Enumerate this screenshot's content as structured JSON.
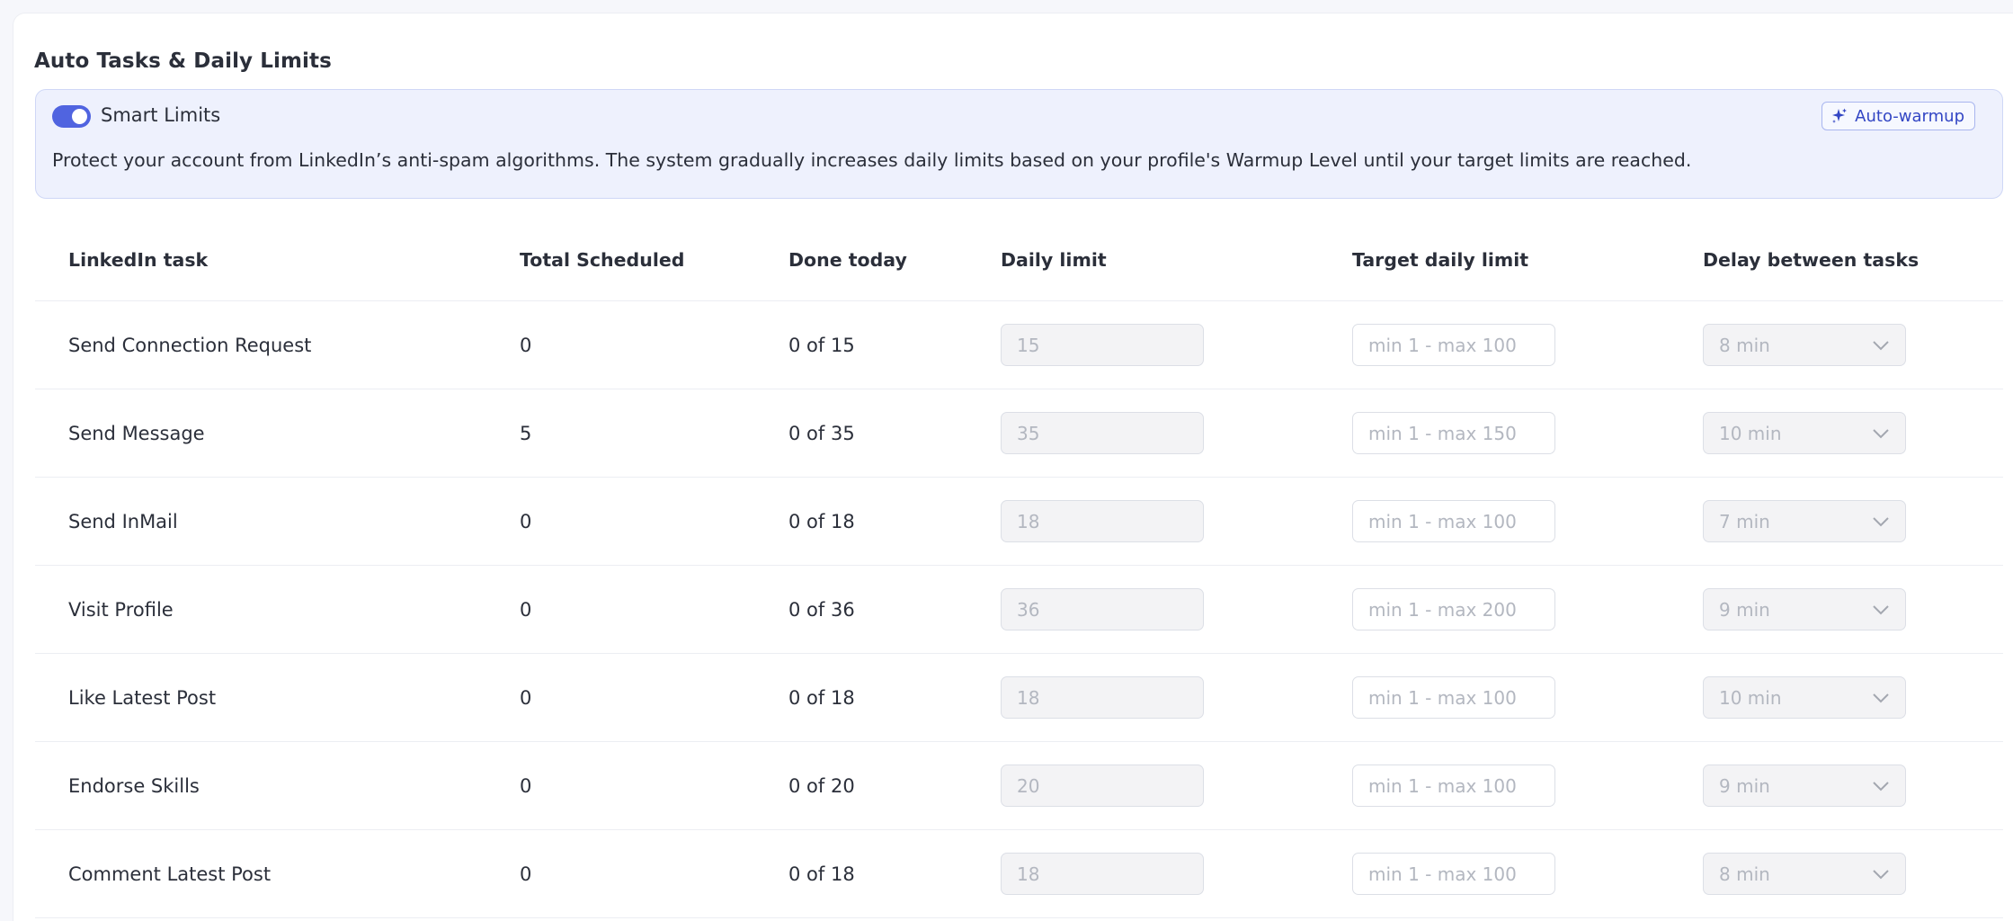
{
  "card": {
    "title": "Auto Tasks & Daily Limits"
  },
  "smart_limits": {
    "enabled": true,
    "label": "Smart Limits",
    "auto_warmup_label": "Auto-warmup",
    "description": "Protect your account from LinkedIn’s anti-spam algorithms. The system gradually increases daily limits based on your profile's Warmup Level until your target limits are reached.",
    "accent_color": "#5064e0"
  },
  "table": {
    "headers": [
      "LinkedIn task",
      "Total Scheduled",
      "Done today",
      "Daily limit",
      "Target daily limit",
      "Delay between tasks"
    ],
    "rows": [
      {
        "task": "Send Connection Request",
        "total": "0",
        "done": "0 of 15",
        "daily_limit": "15",
        "target_placeholder": "min 1 - max 100",
        "delay": "8 min"
      },
      {
        "task": "Send Message",
        "total": "5",
        "done": "0 of 35",
        "daily_limit": "35",
        "target_placeholder": "min 1 - max 150",
        "delay": "10 min"
      },
      {
        "task": "Send InMail",
        "total": "0",
        "done": "0 of 18",
        "daily_limit": "18",
        "target_placeholder": "min 1 - max 100",
        "delay": "7 min"
      },
      {
        "task": "Visit Profile",
        "total": "0",
        "done": "0 of 36",
        "daily_limit": "36",
        "target_placeholder": "min 1 - max 200",
        "delay": "9 min"
      },
      {
        "task": "Like Latest Post",
        "total": "0",
        "done": "0 of 18",
        "daily_limit": "18",
        "target_placeholder": "min 1 - max 100",
        "delay": "10 min"
      },
      {
        "task": "Endorse Skills",
        "total": "0",
        "done": "0 of 20",
        "daily_limit": "20",
        "target_placeholder": "min 1 - max 100",
        "delay": "9 min"
      },
      {
        "task": "Comment Latest Post",
        "total": "0",
        "done": "0 of 18",
        "daily_limit": "18",
        "target_placeholder": "min 1 - max 100",
        "delay": "8 min"
      }
    ]
  },
  "icons": {
    "auto_warmup": "sparkle-icon",
    "delay_select": "chevron-down-icon"
  }
}
